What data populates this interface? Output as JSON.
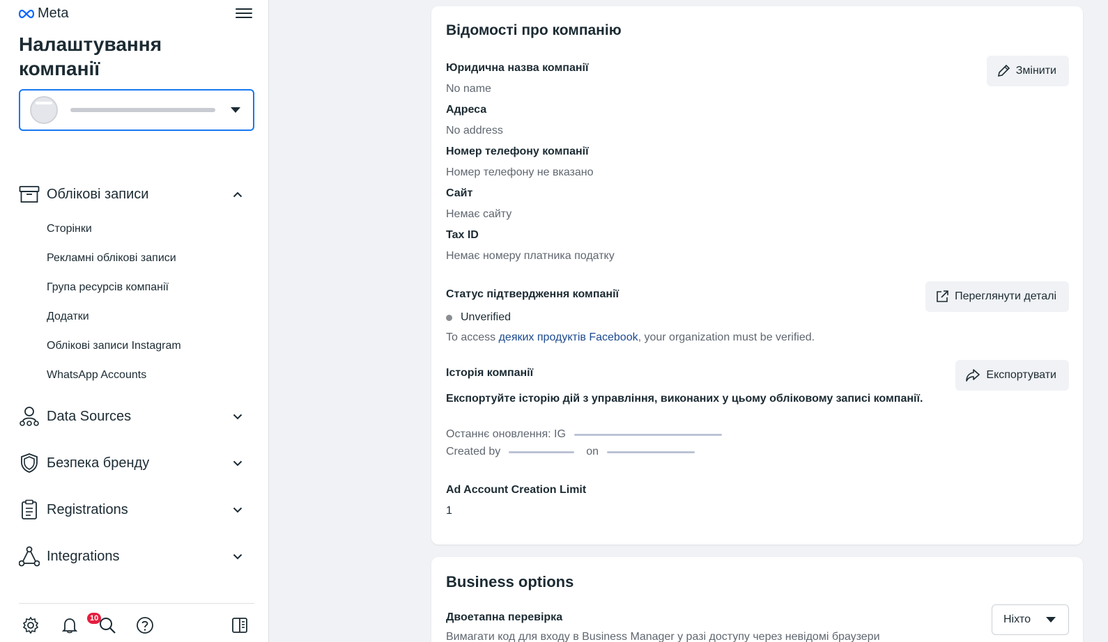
{
  "app": {
    "brand": "Meta",
    "title": "Налаштування компанії"
  },
  "sidebar": {
    "account_select": {
      "value": ""
    },
    "sections": [
      {
        "label": "Облікові записи",
        "icon": "archive-icon",
        "expanded": true,
        "items": [
          {
            "label": "Сторінки"
          },
          {
            "label": "Рекламні облікові записи"
          },
          {
            "label": "Група ресурсів компанії"
          },
          {
            "label": "Додатки"
          },
          {
            "label": "Облікові записи Instagram"
          },
          {
            "label": "WhatsApp Accounts"
          }
        ]
      },
      {
        "label": "Data Sources",
        "icon": "data-sources-icon",
        "expanded": false
      },
      {
        "label": "Безпека бренду",
        "icon": "shield-icon",
        "expanded": false
      },
      {
        "label": "Registrations",
        "icon": "clipboard-icon",
        "expanded": false
      },
      {
        "label": "Integrations",
        "icon": "integrations-icon",
        "expanded": false
      }
    ],
    "bottom": {
      "notification_count": "10"
    }
  },
  "company_info": {
    "title": "Відомості про компанію",
    "edit_button": "Змінити",
    "fields": [
      {
        "label": "Юридична назва компанії",
        "value": "No name"
      },
      {
        "label": "Адреса",
        "value": "No address"
      },
      {
        "label": "Номер телефону компанії",
        "value": "Номер телефону не вказано"
      },
      {
        "label": "Сайт",
        "value": "Немає сайту"
      },
      {
        "label": "Tax ID",
        "value": "Немає номеру платника податку"
      }
    ],
    "verification": {
      "label": "Статус підтвердження компанії",
      "status": "Unverified",
      "button": "Переглянути деталі",
      "text_before": "To access ",
      "link": "деяких продуктів Facebook",
      "text_after": ", your organization must be verified."
    },
    "history": {
      "label": "Історія компанії",
      "button": "Експортувати",
      "description": "Експортуйте історію дій з управління, виконаних у цьому обліковому записі компанії.",
      "last_updated": "Останнє оновлення: IG",
      "created_by": "Created by",
      "on": "on"
    },
    "ad_limit": {
      "label": "Ad Account Creation Limit",
      "value": "1"
    }
  },
  "business_options": {
    "title": "Business options",
    "two_factor": {
      "label": "Двоетапна перевірка",
      "description": "Вимагати код для входу в Business Manager у разі доступу через невідомі браузери",
      "selected": "Ніхто"
    }
  },
  "colors": {
    "accent": "#1877f2",
    "badge": "#e41e3f",
    "link": "#1c4a8e"
  }
}
